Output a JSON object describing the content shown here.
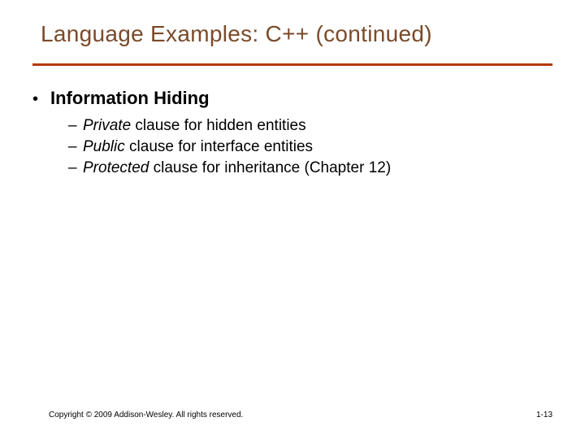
{
  "title": "Language Examples: C++ (continued)",
  "bullets": [
    {
      "label": "Information Hiding",
      "sub": [
        {
          "italic": "Private",
          "rest": " clause for hidden entities"
        },
        {
          "italic": "Public",
          "rest": " clause for interface entities"
        },
        {
          "italic": "Protected",
          "rest": " clause for inheritance (Chapter 12)"
        }
      ]
    }
  ],
  "footer": {
    "copyright": "Copyright © 2009 Addison-Wesley. All rights reserved.",
    "page": "1-13"
  }
}
